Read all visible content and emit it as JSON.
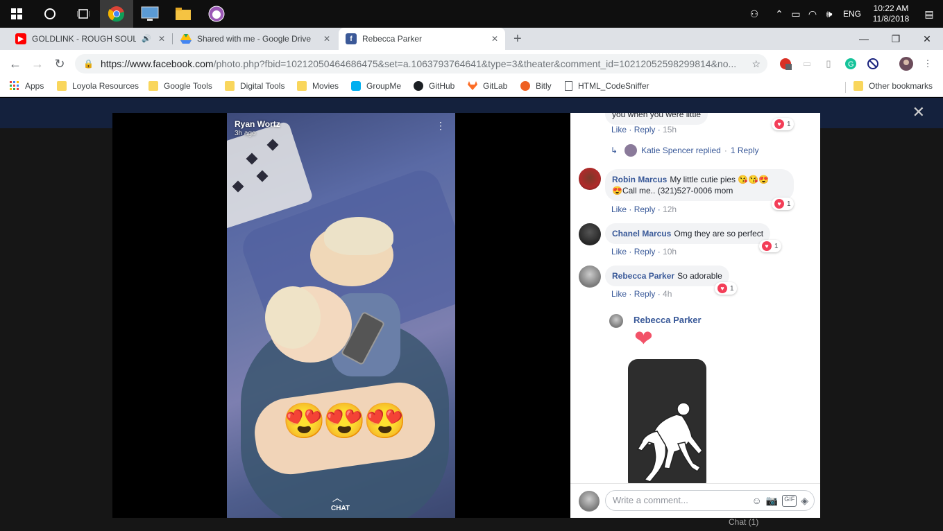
{
  "taskbar": {
    "clock_time": "10:22 AM",
    "clock_date": "11/8/2018",
    "language": "ENG"
  },
  "tabs": [
    {
      "title": "GOLDLINK - ROUGH SOUL (",
      "favicon": "youtube-icon",
      "color": "#ff0000"
    },
    {
      "title": "Shared with me - Google Drive",
      "favicon": "google-drive-icon",
      "color": "#1fa463"
    },
    {
      "title": "Rebecca Parker",
      "favicon": "facebook-icon",
      "color": "#3b5998"
    }
  ],
  "address": {
    "url_host": "https://www.facebook.com",
    "url_path": "/photo.php?fbid=10212050464686475&set=a.1063793764641&type=3&theater&comment_id=10212052598299814&no..."
  },
  "bookmarks": [
    {
      "label": "Apps",
      "icon": "apps-grid-icon"
    },
    {
      "label": "Loyola Resources",
      "icon": "folder-icon"
    },
    {
      "label": "Google Tools",
      "icon": "folder-icon"
    },
    {
      "label": "Digital Tools",
      "icon": "folder-icon"
    },
    {
      "label": "Movies",
      "icon": "folder-icon"
    },
    {
      "label": "GroupMe",
      "icon": "groupme-icon"
    },
    {
      "label": "GitHub",
      "icon": "github-icon"
    },
    {
      "label": "GitLab",
      "icon": "gitlab-icon"
    },
    {
      "label": "Bitly",
      "icon": "bitly-icon"
    },
    {
      "label": "HTML_CodeSniffer",
      "icon": "page-icon"
    },
    {
      "label": "Other bookmarks",
      "icon": "folder-icon"
    }
  ],
  "photo": {
    "username": "Ryan Wortz",
    "time_ago": "3h ago",
    "emojis": "😍😍😍",
    "chat_label": "CHAT"
  },
  "comments": {
    "top_partial": {
      "text": "you when you were little",
      "like": "Like",
      "reply": "Reply",
      "time": "15h",
      "reactions": "1"
    },
    "reply_summary": {
      "author": "Katie Spencer",
      "text": "replied",
      "count": "1 Reply"
    },
    "items": [
      {
        "author": "Robin Marcus",
        "text_line1": "My little cutie pies 😘😘😍",
        "text_line2": "😍Call me.. (321)527-0006 mom",
        "like": "Like",
        "reply": "Reply",
        "time": "12h",
        "reactions": "1"
      },
      {
        "author": "Chanel Marcus",
        "text_line1": "Omg they are so perfect",
        "like": "Like",
        "reply": "Reply",
        "time": "10h",
        "reactions": "1"
      },
      {
        "author": "Rebecca Parker",
        "text_line1": "So adorable",
        "like": "Like",
        "reply": "Reply",
        "time": "4h",
        "reactions": "1"
      }
    ],
    "nested_reply": {
      "author": "Rebecca Parker",
      "emoji": "❤"
    },
    "write_placeholder": "Write a comment..."
  },
  "bottom_chat": "Chat (1)"
}
